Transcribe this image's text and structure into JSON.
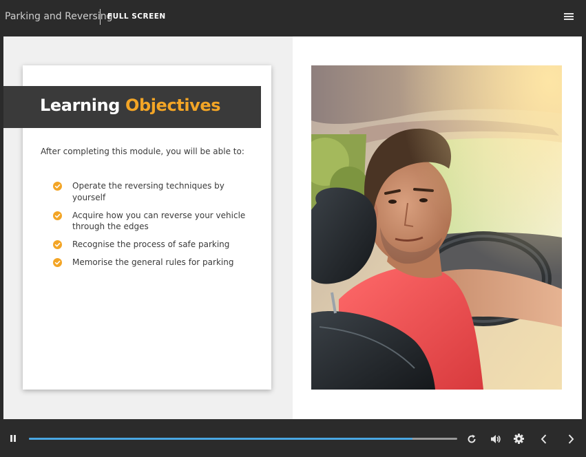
{
  "header": {
    "course_title": "Parking and Reversing",
    "fullscreen_label": "FULL SCREEN"
  },
  "slide": {
    "title_part1": "Learning",
    "title_part2": "Objectives",
    "intro": "After completing this module, you will be able to:",
    "objectives": [
      "Operate the reversing techniques by yourself",
      "Acquire how you can reverse your vehicle through the edges",
      "Recognise the process of safe parking",
      "Memorise the general rules for parking"
    ],
    "photo_alt": "Man in a red shirt looking over his shoulder while reversing a car"
  },
  "player": {
    "progress": 0.895,
    "icons": [
      "pause-icon",
      "replay-icon",
      "volume-icon",
      "settings-icon",
      "previous-icon",
      "next-icon",
      "menu-icon"
    ]
  },
  "colors": {
    "accent": "#f3a526",
    "progress": "#4aa7e3",
    "chrome": "#2b2b2b"
  }
}
